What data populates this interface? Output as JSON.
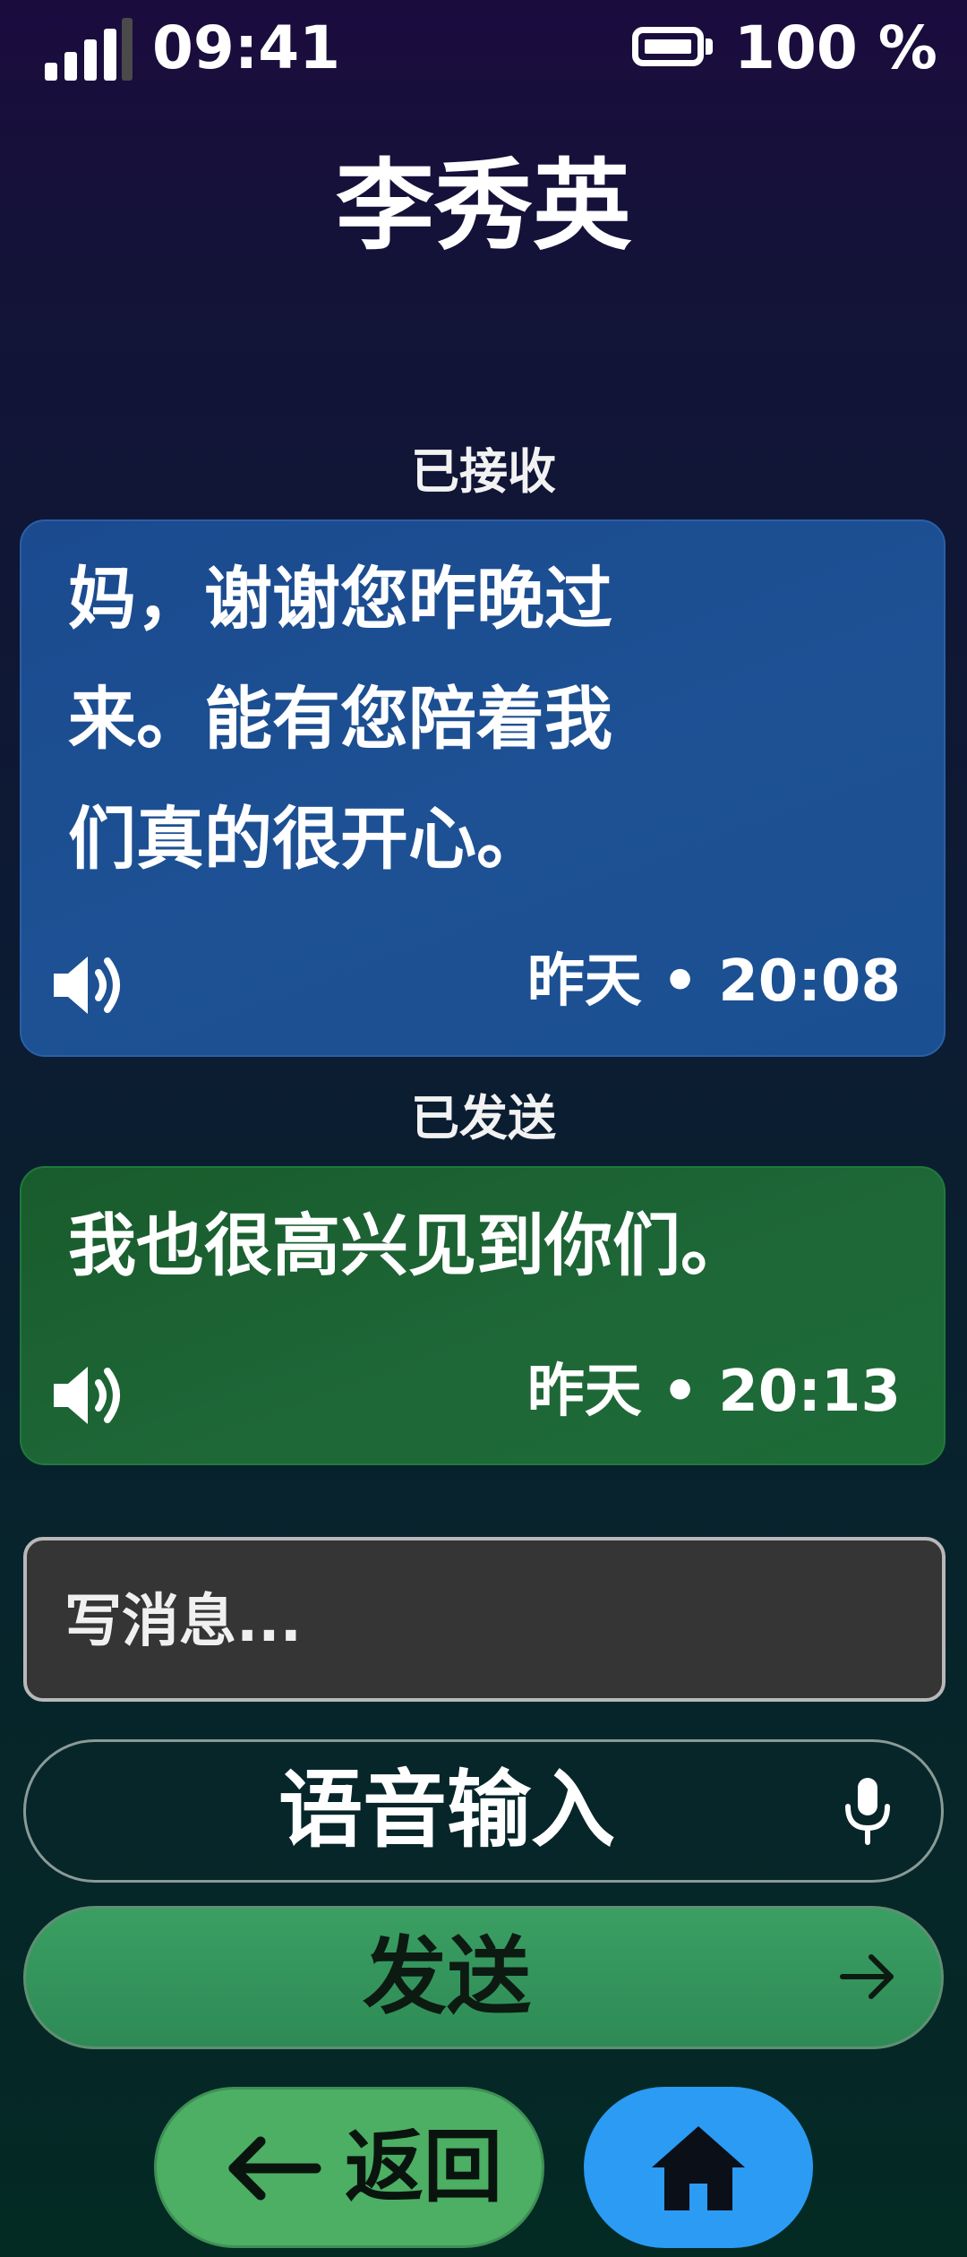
{
  "status_bar": {
    "time": "09:41",
    "battery": "100 %",
    "signal_icon": "signal-bars-icon",
    "battery_icon": "battery-full-icon"
  },
  "contact": {
    "name": "李秀英"
  },
  "messages": [
    {
      "direction_label": "已接收",
      "lines": [
        "妈，谢谢您昨晚过",
        "来。能有您陪着我",
        "们真的很开心。"
      ],
      "timestamp": "昨天 • 20:08",
      "speaker_icon": "speaker-icon",
      "color": "#1d5194"
    },
    {
      "direction_label": "已发送",
      "lines": [
        "我也很高兴见到你们。"
      ],
      "timestamp": "昨天 • 20:13",
      "speaker_icon": "speaker-icon",
      "color": "#1e6838"
    }
  ],
  "compose": {
    "placeholder": "写消息...",
    "value": ""
  },
  "actions": {
    "voice_label": "语音输入",
    "voice_icon": "microphone-icon",
    "send_label": "发送",
    "send_icon": "arrow-right-icon",
    "send_color": "#2e8a55"
  },
  "nav": {
    "back_label": "返回",
    "back_icon": "arrow-left-icon",
    "home_icon": "home-icon",
    "back_color": "#4caf64",
    "home_color": "#2b9bf4"
  }
}
